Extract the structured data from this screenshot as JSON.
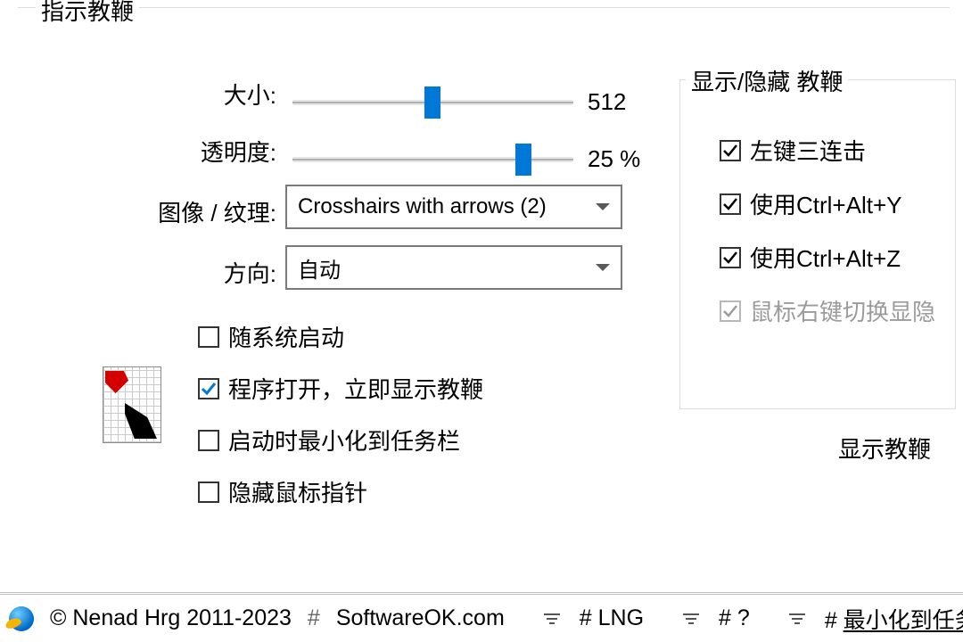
{
  "group_title": "指示教鞭",
  "sliders": {
    "size_label": "大小:",
    "size_value": "512",
    "opacity_label": "透明度:",
    "opacity_value": "25 %"
  },
  "dropdowns": {
    "texture_label": "图像 / 纹理:",
    "texture_value": "Crosshairs with arrows (2)",
    "direction_label": "方向:",
    "direction_value": "自动"
  },
  "left_checks": {
    "autostart": "随系统启动",
    "show_on_open": "程序打开，立即显示教鞭",
    "min_to_tray": "启动时最小化到任务栏",
    "hide_cursor": "隐藏鼠标指针"
  },
  "right_group_title": "显示/隐藏 教鞭",
  "right_checks": {
    "triple_click": "左键三连击",
    "ctrl_alt_y": "使用Ctrl+Alt+Y",
    "ctrl_alt_z": "使用Ctrl+Alt+Z",
    "rmb_toggle": "鼠标右键切换显隐"
  },
  "show_pointer_link": "显示教鞭",
  "footer": {
    "copyright": "© Nenad Hrg 2011-2023",
    "site": "SoftwareOK.com",
    "lng": "LNG",
    "help": "?",
    "minimize": "最小化到任务栏"
  }
}
